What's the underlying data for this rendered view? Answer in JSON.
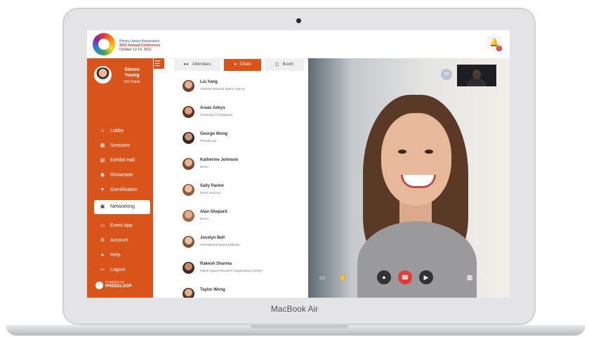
{
  "device": {
    "brand": "MacBook Air"
  },
  "header": {
    "org_line1": "Illinois Library Association",
    "org_line2": "2021 Annual Conference",
    "org_line3": "October 12-14, 2021",
    "notification_count": "1"
  },
  "user": {
    "name_first": "Simon",
    "name_last": "Young",
    "points": "191 Points"
  },
  "sidebar": {
    "items": [
      {
        "label": "Lobby",
        "icon": "home-icon"
      },
      {
        "label": "Sessions",
        "icon": "calendar-icon"
      },
      {
        "label": "Exhibit Hall",
        "icon": "store-icon"
      },
      {
        "label": "Showcase",
        "icon": "medal-icon"
      },
      {
        "label": "Gamification",
        "icon": "trophy-icon"
      },
      {
        "label": "Networking",
        "icon": "chat-icon"
      },
      {
        "label": "Event App",
        "icon": "phone-icon"
      },
      {
        "label": "Account",
        "icon": "gear-icon"
      },
      {
        "label": "Help",
        "icon": "info-icon"
      },
      {
        "label": "Logout",
        "icon": "logout-icon"
      }
    ],
    "active": "Networking",
    "powered_by": "POWERED BY",
    "powered_brand": "PHEEDLOOP"
  },
  "tabs": [
    {
      "label": "Attendees",
      "icon": "users-icon"
    },
    {
      "label": "Chats",
      "icon": "chat-icon"
    },
    {
      "label": "Booth",
      "icon": "booth-icon"
    }
  ],
  "active_tab": "Chats",
  "contacts": [
    {
      "name": "Liu Yang",
      "org": "Chinese National Space Agency"
    },
    {
      "name": "Araaz Adeys",
      "org": "University of Singapore"
    },
    {
      "name": "George Wong",
      "org": "PheedLoop"
    },
    {
      "name": "Katherine Johnson",
      "org": "NASA"
    },
    {
      "name": "Sally Parker",
      "org": "Event Host Inc."
    },
    {
      "name": "Alan Shepard",
      "org": "NASA"
    },
    {
      "name": "Jocelyn Bell",
      "org": "International Space Institute"
    },
    {
      "name": "Rakesh Sharma",
      "org": "Indian Space Research Organisation (ISRO)"
    },
    {
      "name": "Taylor Wong",
      "org": ""
    }
  ],
  "video": {
    "participant_initials": "HD"
  },
  "colors": {
    "accent": "#d9541a",
    "danger": "#e53935"
  }
}
